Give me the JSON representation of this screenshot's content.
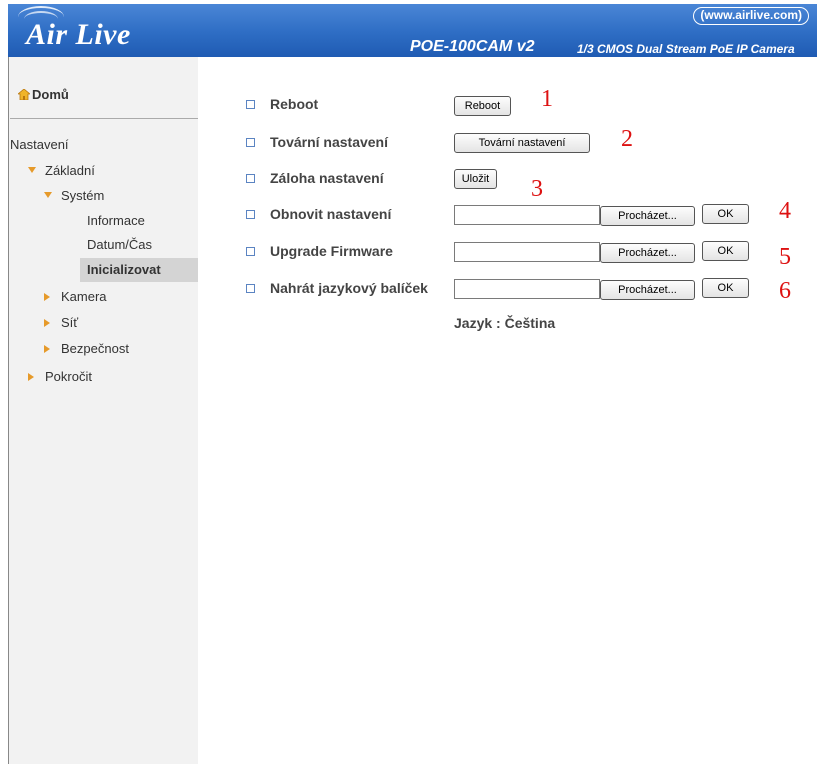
{
  "header": {
    "logo": "Air Live",
    "site_link": "(www.airlive.com)",
    "model": "POE-100CAM v2",
    "sensor": "1/3 CMOS Dual Stream PoE IP Camera"
  },
  "sidebar": {
    "home": "Domů",
    "section": "Nastavení",
    "basic": "Základní",
    "system": "Systém",
    "info": "Informace",
    "datetime": "Datum/Čas",
    "init": "Inicializovat",
    "camera": "Kamera",
    "network": "Síť",
    "security": "Bezpečnost",
    "advanced": "Pokročit"
  },
  "main": {
    "rows": [
      {
        "label": "Reboot",
        "button": "Reboot",
        "annotation": "1"
      },
      {
        "label": "Tovární nastavení",
        "button": "Tovární nastavení",
        "annotation": "2"
      },
      {
        "label": "Záloha nastavení",
        "button": "Uložit",
        "annotation": "3"
      },
      {
        "label": "Obnovit nastavení",
        "browse": "Procházet...",
        "ok": "OK",
        "annotation": "4"
      },
      {
        "label": "Upgrade Firmware",
        "browse": "Procházet...",
        "ok": "OK",
        "annotation": "5"
      },
      {
        "label": "Nahrát jazykový balíček",
        "browse": "Procházet...",
        "ok": "OK",
        "annotation": "6"
      }
    ],
    "language": "Jazyk : Čeština"
  },
  "colors": {
    "header_blue": "#2e6dc4",
    "annotation_red": "#dd1111",
    "bullet_blue": "#5b84c2",
    "nav_arrow": "#e69a2a"
  }
}
